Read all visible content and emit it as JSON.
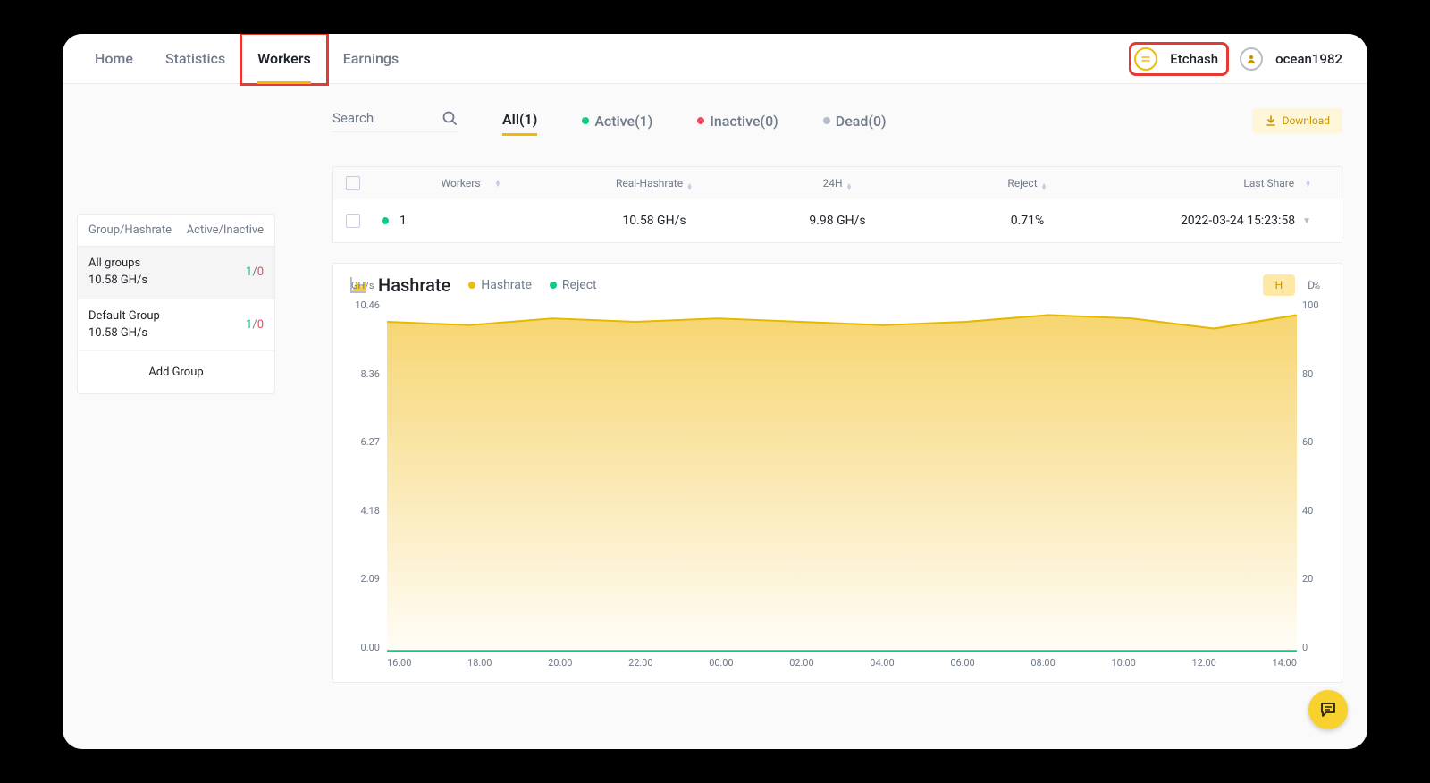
{
  "nav": {
    "home": "Home",
    "statistics": "Statistics",
    "workers": "Workers",
    "earnings": "Earnings",
    "coin": "Etchash",
    "user": "ocean1982"
  },
  "sidebar": {
    "head_left": "Group/Hashrate",
    "head_right": "Active/Inactive",
    "groups": [
      {
        "name": "All groups",
        "rate": "10.58 GH/s",
        "active": "1",
        "inactive": "0"
      },
      {
        "name": "Default Group",
        "rate": "10.58 GH/s",
        "active": "1",
        "inactive": "0"
      }
    ],
    "add": "Add Group"
  },
  "filters": {
    "search": "Search",
    "all": "All(1)",
    "active": "Active(1)",
    "inactive": "Inactive(0)",
    "dead": "Dead(0)",
    "download": "Download"
  },
  "table": {
    "headers": {
      "workers": "Workers",
      "real": "Real-Hashrate",
      "h24": "24H",
      "reject": "Reject",
      "last": "Last Share"
    },
    "row": {
      "worker": "1",
      "real": "10.58 GH/s",
      "h24": "9.98 GH/s",
      "reject": "0.71%",
      "last": "2022-03-24 15:23:58"
    }
  },
  "chart": {
    "title": "Hashrate",
    "legend_hash": "Hashrate",
    "legend_reject": "Reject",
    "toggle_h": "H",
    "toggle_d": "D",
    "y_left_unit": "GH/s",
    "y_right_unit": "%",
    "y_left": [
      "10.46",
      "8.36",
      "6.27",
      "4.18",
      "2.09",
      "0.00"
    ],
    "y_right": [
      "100",
      "80",
      "60",
      "40",
      "20",
      "0"
    ],
    "x": [
      "16:00",
      "18:00",
      "20:00",
      "22:00",
      "00:00",
      "02:00",
      "04:00",
      "06:00",
      "08:00",
      "10:00",
      "12:00",
      "14:00"
    ]
  },
  "chart_data": {
    "type": "line",
    "xlabel": "",
    "ylabel_left": "GH/s",
    "ylabel_right": "%",
    "ylim_left": [
      0,
      10.46
    ],
    "ylim_right": [
      0,
      100
    ],
    "x": [
      "16:00",
      "18:00",
      "20:00",
      "22:00",
      "00:00",
      "02:00",
      "04:00",
      "06:00",
      "08:00",
      "10:00",
      "12:00",
      "14:00"
    ],
    "series": [
      {
        "name": "Hashrate",
        "axis": "left",
        "values": [
          9.8,
          9.7,
          9.9,
          9.8,
          9.9,
          9.8,
          9.7,
          9.8,
          10.0,
          9.9,
          9.6,
          10.0
        ]
      },
      {
        "name": "Reject",
        "axis": "right",
        "values": [
          0.7,
          0.7,
          0.7,
          0.7,
          0.7,
          0.7,
          0.7,
          0.7,
          0.7,
          0.7,
          0.7,
          0.7
        ]
      }
    ]
  }
}
